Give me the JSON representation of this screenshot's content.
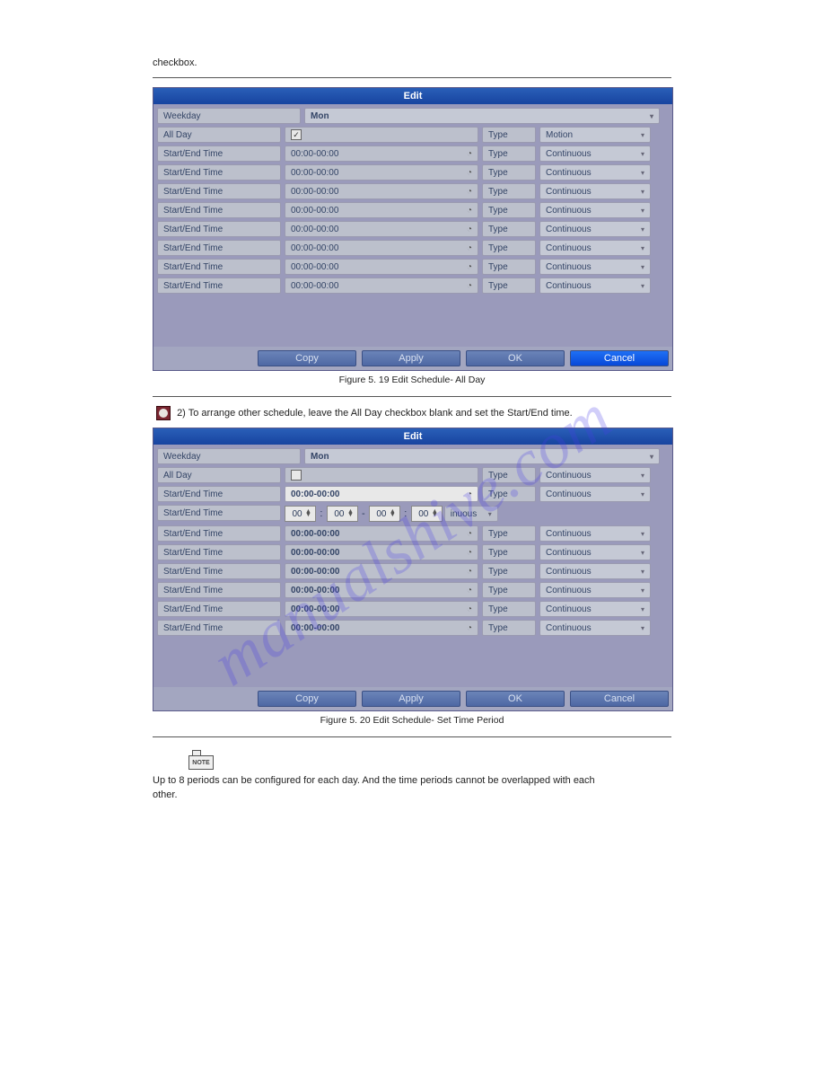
{
  "page": {
    "line_top": "checkbox.",
    "caption1": "Figure 5. 19 Edit Schedule- All Day",
    "line_mid": "2) To arrange other schedule, leave the All Day checkbox blank and set the Start/End time.",
    "caption2": "Figure 5. 20 Edit Schedule- Set Time Period",
    "note_text": "NOTE",
    "line_note1": "Up to 8 periods can be configured for each day. And the time periods cannot be overlapped with each",
    "line_note2": "other."
  },
  "panel1": {
    "title": "Edit",
    "weekday_label": "Weekday",
    "weekday_value": "Mon",
    "allday_label": "All Day",
    "allday_checked": true,
    "type_label": "Type",
    "allday_type": "Motion",
    "row_label": "Start/End Time",
    "row_time": "00:00-00:00",
    "row_type_label": "Type",
    "row_type_value": "Continuous",
    "buttons": {
      "copy": "Copy",
      "apply": "Apply",
      "ok": "OK",
      "cancel": "Cancel"
    }
  },
  "panel2": {
    "title": "Edit",
    "weekday_label": "Weekday",
    "weekday_value": "Mon",
    "allday_label": "All Day",
    "allday_checked": false,
    "type_label": "Type",
    "allday_type": "Continuous",
    "row_label": "Start/End Time",
    "row_time": "00:00-00:00",
    "row_type_label": "Type",
    "row_type_value": "Continuous",
    "spinner": {
      "h1": "00",
      "m1": "00",
      "h2": "00",
      "m2": "00",
      "tail": "inuous"
    },
    "buttons": {
      "copy": "Copy",
      "apply": "Apply",
      "ok": "OK",
      "cancel": "Cancel"
    }
  },
  "watermark": "manualshive.com"
}
